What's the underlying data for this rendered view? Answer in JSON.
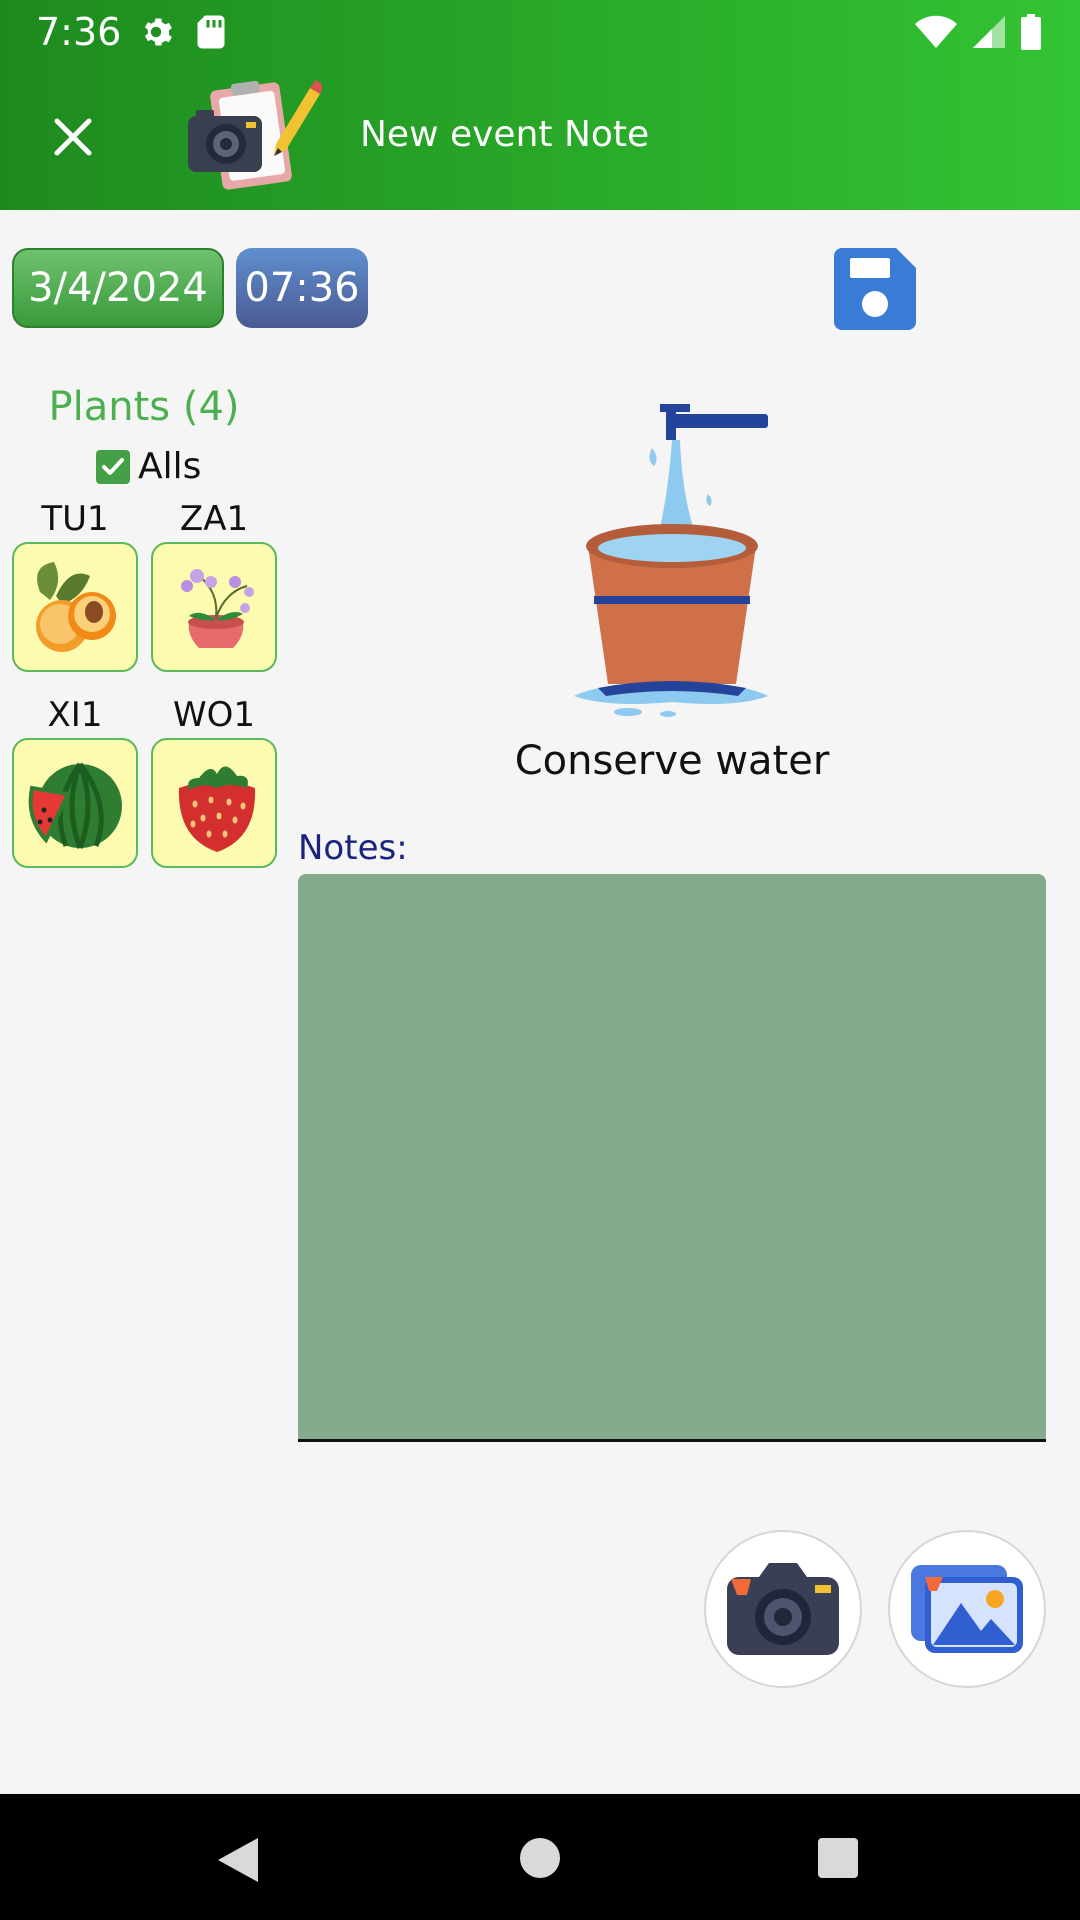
{
  "status_bar": {
    "time": "7:36",
    "left_icons": [
      "gear-icon",
      "sd-card-icon"
    ],
    "right_icons": [
      "wifi-icon",
      "signal-icon",
      "battery-icon"
    ]
  },
  "app_bar": {
    "close_icon": "close-icon",
    "logo_icon": "camera-clipboard-pencil-icon",
    "title": "New event Note",
    "color_start": "#1e8a1e",
    "color_end": "#33c433"
  },
  "toolbar": {
    "date": "3/4/2024",
    "time": "07:36",
    "save_icon": "floppy-disk-icon",
    "save_color": "#3a7bd5"
  },
  "plants": {
    "title": "Plants (4)",
    "alls_label": "Alls",
    "alls_checked": true,
    "items": [
      {
        "label": "TU1",
        "icon": "apricot-icon"
      },
      {
        "label": "ZA1",
        "icon": "orchid-pot-icon"
      },
      {
        "label": "XI1",
        "icon": "watermelon-icon"
      },
      {
        "label": "WO1",
        "icon": "strawberry-icon"
      }
    ]
  },
  "event": {
    "icon": "faucet-pot-water-icon",
    "name": "Conserve water"
  },
  "notes": {
    "label": "Notes:",
    "value": "",
    "background": "#85ab8c"
  },
  "actions": {
    "camera_icon": "camera-icon",
    "gallery_icon": "gallery-icon"
  },
  "nav_bar": {
    "back_icon": "back-triangle-icon",
    "home_icon": "home-circle-icon",
    "recent_icon": "recent-square-icon"
  }
}
